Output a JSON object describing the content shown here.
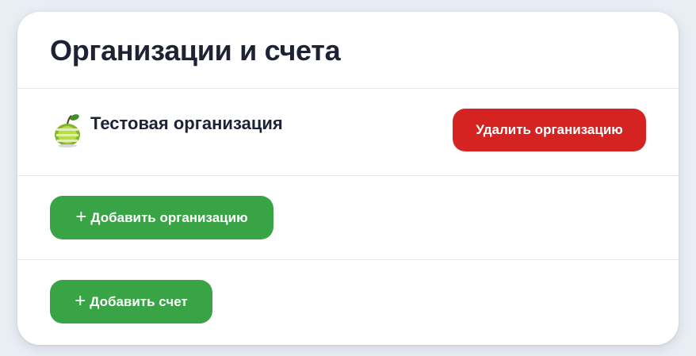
{
  "page": {
    "title": "Организации и счета"
  },
  "organization": {
    "name": "Тестовая организация",
    "logo_icon": "green-apple-logo",
    "delete_label": "Удалить организацию"
  },
  "actions": {
    "add_org_label": "Добавить организацию",
    "add_account_label": "Добавить счет",
    "plus_icon": "+"
  },
  "colors": {
    "danger": "#d42320",
    "success": "#38a446",
    "text": "#1e2235"
  }
}
